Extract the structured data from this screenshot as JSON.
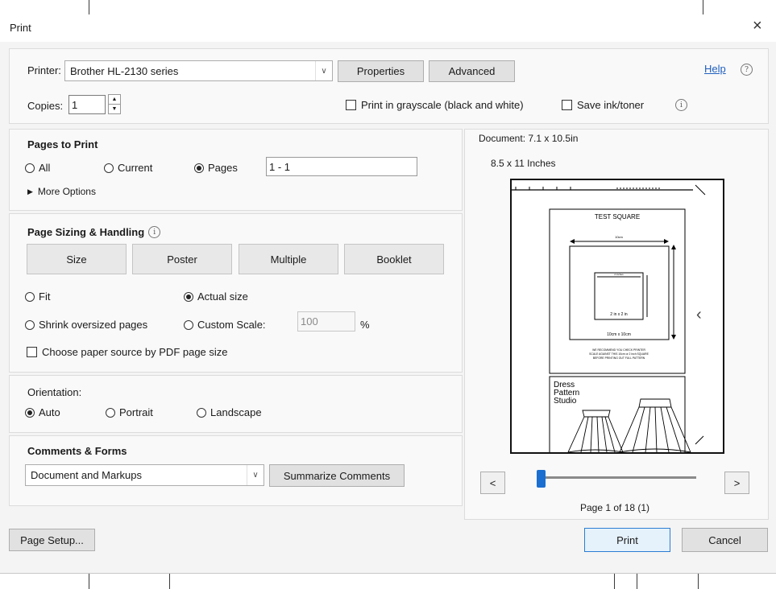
{
  "dialog": {
    "title": "Print",
    "close": "×"
  },
  "printer": {
    "label": "Printer:",
    "selected": "Brother HL-2130 series",
    "properties": "Properties",
    "advanced": "Advanced",
    "help": "Help",
    "copies_label": "Copies:",
    "copies_value": "1",
    "grayscale": "Print in grayscale (black and white)",
    "save_ink": "Save ink/toner"
  },
  "pages_to_print": {
    "heading": "Pages to Print",
    "all": "All",
    "current": "Current",
    "pages": "Pages",
    "pages_value": "1 - 1",
    "more_options": "More Options"
  },
  "sizing": {
    "heading": "Page Sizing & Handling",
    "size": "Size",
    "poster": "Poster",
    "multiple": "Multiple",
    "booklet": "Booklet",
    "fit": "Fit",
    "actual": "Actual size",
    "shrink": "Shrink oversized pages",
    "custom": "Custom Scale:",
    "scale_value": "100",
    "percent": "%",
    "paper_source": "Choose paper source by PDF page size"
  },
  "orientation": {
    "heading": "Orientation:",
    "auto": "Auto",
    "portrait": "Portrait",
    "landscape": "Landscape"
  },
  "comments": {
    "heading": "Comments & Forms",
    "selected": "Document and Markups",
    "summarize": "Summarize Comments"
  },
  "preview": {
    "document_size": "Document: 7.1 x 10.5in",
    "paper_size": "8.5 x 11 Inches",
    "prev": "<",
    "next": ">",
    "page_status": "Page 1 of 18 (1)",
    "slider_fraction": 0.0,
    "page_content": {
      "test_square": "TEST SQUARE",
      "dim_10cm": "10cm",
      "dim_2inch": "2 inches",
      "inner_label": "2 in x 2 in",
      "outer_label": "10cm x 10cm",
      "note_1": "WE RECOMMEND YOU CHECK PRINTER",
      "note_2": "SCALE AGAINST THIS 10cm or 2 inch SQUARE",
      "note_3": "BEFORE PRINTING OUT FULL PATTERN",
      "brand_1": "Dress",
      "brand_2": "Pattern",
      "brand_3": "Studio"
    }
  },
  "footer": {
    "page_setup": "Page Setup...",
    "print": "Print",
    "cancel": "Cancel"
  }
}
